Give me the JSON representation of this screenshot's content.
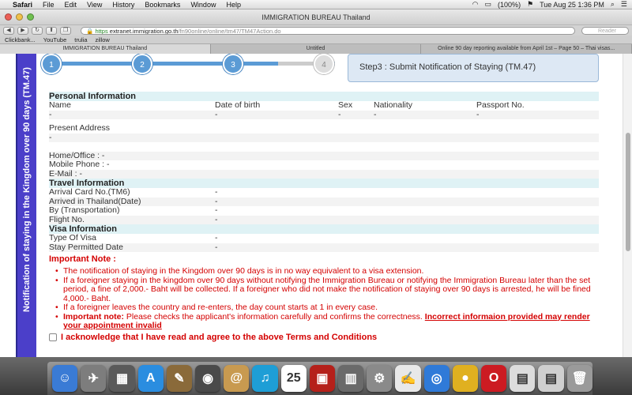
{
  "menubar": {
    "app": "Safari",
    "items": [
      "File",
      "Edit",
      "View",
      "History",
      "Bookmarks",
      "Window",
      "Help"
    ],
    "battery": "(100%)",
    "datetime": "Tue Aug 25  1:36 PM"
  },
  "window": {
    "title": "IMMIGRATION BUREAU Thailand"
  },
  "toolbar": {
    "url_prefix": "https",
    "url_host": "extranet.immigration.go.th",
    "url_path": "/fn90online/online/tm47/TM47Action.do",
    "reader_placeholder": "Reader"
  },
  "bookmarks": [
    "Clickbank...",
    "YouTube",
    "trulia",
    "zillow"
  ],
  "tabs": [
    "IMMIGRATION BUREAU Thailand",
    "Untitled",
    "Online 90 day reporting available from April 1st – Page 50 – Thai visas..."
  ],
  "sidebar": {
    "text": "Notification of staying in the Kingdom over 90 days (TM.47)"
  },
  "steps": {
    "numbers": [
      "1",
      "2",
      "3",
      "4"
    ],
    "current_label": "Step3 : Submit Notification of Staying (TM.47)"
  },
  "personal": {
    "header": "Personal Information",
    "columns": [
      "Name",
      "Date of birth",
      "Sex",
      "Nationality",
      "Passport No."
    ],
    "values": [
      "-",
      "-",
      "-",
      "-",
      "-"
    ],
    "present_address_label": "Present Address",
    "present_address_value": "-",
    "home_office": "Home/Office : -",
    "mobile_phone": "Mobile Phone : -",
    "email": "E-Mail : -"
  },
  "travel": {
    "header": "Travel Information",
    "rows": [
      {
        "label": "Arrival Card No.(TM6)",
        "value": "-"
      },
      {
        "label": "Arrived in Thailand(Date)",
        "value": "-"
      },
      {
        "label": "By (Transportation)",
        "value": "-"
      },
      {
        "label": "Flight No.",
        "value": "-"
      }
    ]
  },
  "visa": {
    "header": "Visa Information",
    "rows": [
      {
        "label": "Type Of Visa",
        "value": "-"
      },
      {
        "label": "Stay Permitted Date",
        "value": "-"
      }
    ]
  },
  "notes": {
    "title": "Important Note :",
    "item1": "The notification of staying in the Kingdom over 90 days is in no way equivalent to a visa extension.",
    "item2": "If a foreigner staying in the kingdom over 90 days without notifying the Immigration Bureau or notifying the Immigration Bureau later than the set period, a fine of 2,000.- Baht will be collected. If a foreigner who did not make the notification of staying over 90 days is arrested, he will be fined 4,000.- Baht.",
    "item3": "If a foreigner leaves the country and re-enters, the day count starts at 1 in every case.",
    "item4_bold": "Important note:",
    "item4_text": " Please checks the applicant's information carefully and confirms the correctness. ",
    "item4_underline": "Incorrect informaion provided may render your appointment invalid"
  },
  "ack": {
    "label": "I acknowledge that I have read and agree to the above Terms and Conditions"
  },
  "dock": {
    "icons": [
      {
        "name": "finder-icon",
        "color": "#3a7bd5",
        "glyph": "☺"
      },
      {
        "name": "launchpad-icon",
        "color": "#7d7d7d",
        "glyph": "✈"
      },
      {
        "name": "mission-control-icon",
        "color": "#5a5a5a",
        "glyph": "▦"
      },
      {
        "name": "app-store-icon",
        "color": "#2a8de0",
        "glyph": "A"
      },
      {
        "name": "preview-icon",
        "color": "#8a6a3a",
        "glyph": "✎"
      },
      {
        "name": "facetime-icon",
        "color": "#4a4a4a",
        "glyph": "◉"
      },
      {
        "name": "contacts-icon",
        "color": "#c89a50",
        "glyph": "@"
      },
      {
        "name": "itunes-icon",
        "color": "#1e9ed6",
        "glyph": "♫"
      },
      {
        "name": "calendar-icon",
        "color": "#ffffff",
        "glyph": "25"
      },
      {
        "name": "photo-booth-icon",
        "color": "#b5201a",
        "glyph": "▣"
      },
      {
        "name": "photos-icon",
        "color": "#6a6a6a",
        "glyph": "▥"
      },
      {
        "name": "system-preferences-icon",
        "color": "#8a8a8a",
        "glyph": "⚙"
      },
      {
        "name": "textedit-icon",
        "color": "#e8e8e8",
        "glyph": "✍"
      },
      {
        "name": "safari-icon",
        "color": "#2f7ad8",
        "glyph": "◎"
      },
      {
        "name": "chrome-icon",
        "color": "#e0b020",
        "glyph": "●"
      },
      {
        "name": "opera-icon",
        "color": "#cc1b22",
        "glyph": "O"
      },
      {
        "name": "document-icon",
        "color": "#dcdcdc",
        "glyph": "▤"
      },
      {
        "name": "stack-icon",
        "color": "#cfcfcf",
        "glyph": "▤"
      },
      {
        "name": "trash-icon",
        "color": "#9a9a9a",
        "glyph": "🗑"
      }
    ]
  }
}
